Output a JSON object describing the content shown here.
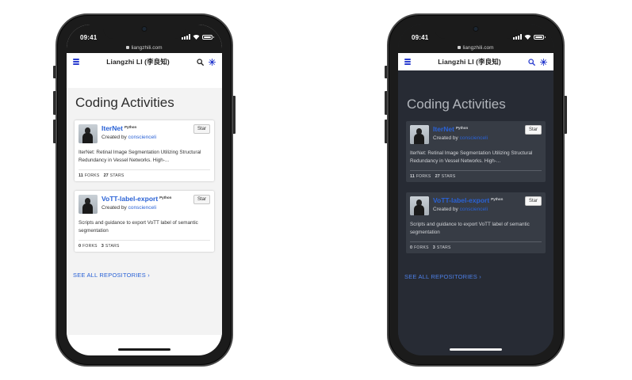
{
  "status": {
    "time": "09:41",
    "url": "liangzhili.com"
  },
  "site": {
    "title": "Liangzhi LI (李良知)"
  },
  "section": {
    "heading": "Coding Activities",
    "see_all": "SEE ALL REPOSITORIES ›"
  },
  "repos": [
    {
      "name": "IterNet",
      "language": "Python",
      "created_by_prefix": "Created by ",
      "owner": "conscienceli",
      "star_label": "Star",
      "description": "IterNet: Retinal Image Segmentation Utilizing Structural Redundancy in Vessel Networks. High-...",
      "forks": "11",
      "forks_label": "FORKS",
      "stars": "27",
      "stars_label": "STARS"
    },
    {
      "name": "VoTT-label-export",
      "language": "Python",
      "created_by_prefix": "Created by ",
      "owner": "conscienceli",
      "star_label": "Star",
      "description": "Scripts and guidance to export VoTT label of semantic segmentation",
      "forks": "0",
      "forks_label": "FORKS",
      "stars": "3",
      "stars_label": "STARS"
    }
  ],
  "icons": [
    "lock-icon",
    "signal-icon",
    "wifi-icon",
    "battery-icon",
    "hamburger-icon",
    "search-icon",
    "theme-toggle-icon"
  ],
  "colors": {
    "link": "#2a62d6",
    "dark_bg": "#272b34",
    "dark_card": "#373c45",
    "light_section": "#f3f3f3",
    "hamburger": "#2a3dcf"
  }
}
